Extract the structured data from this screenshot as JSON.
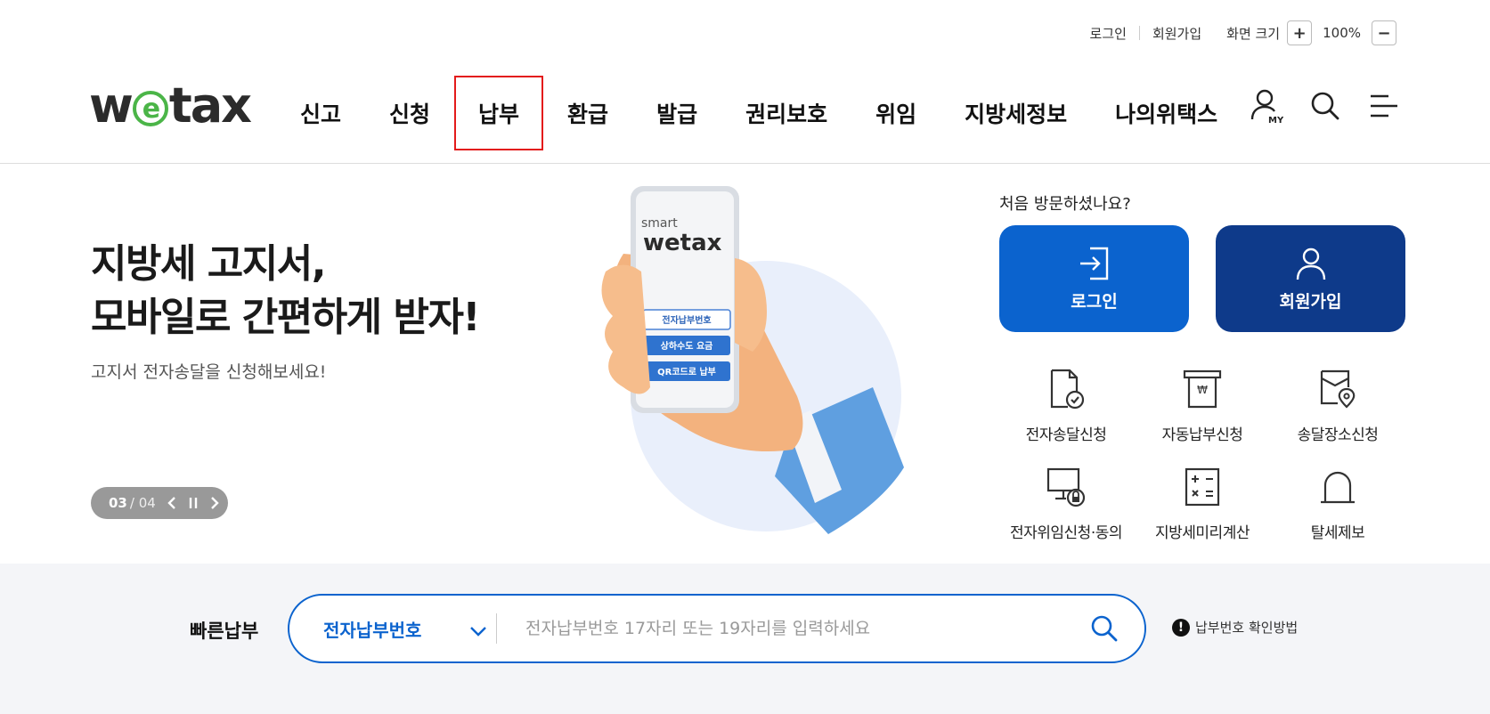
{
  "utility": {
    "login": "로그인",
    "join": "회원가입",
    "zoom_label": "화면 크기",
    "zoom_in": "+",
    "zoom_value": "100%",
    "zoom_out": "−"
  },
  "logo": {
    "before": "w",
    "circle": "e",
    "after": "tax"
  },
  "menu": [
    {
      "label": "신고"
    },
    {
      "label": "신청"
    },
    {
      "label": "납부"
    },
    {
      "label": "환급"
    },
    {
      "label": "발급"
    },
    {
      "label": "권리보호"
    },
    {
      "label": "위임"
    },
    {
      "label": "지방세정보"
    },
    {
      "label": "나의위택스"
    }
  ],
  "header_icons": {
    "my_label": "MY"
  },
  "hero": {
    "title_line1": "지방세 고지서,",
    "title_line2": "모바일로 간편하게 받자!",
    "subtitle": "고지서 전자송달을 신청해보세요!",
    "slide_current": "03",
    "slide_total": "/ 04",
    "phone": {
      "brand_small": "smart",
      "brand_logo": "wetax",
      "btn1": "전자납부번호",
      "btn2": "상하수도 요금",
      "btn3": "QR코드로 납부"
    }
  },
  "visit": {
    "question": "처음 방문하셨나요?",
    "login": "로그인",
    "join": "회원가입"
  },
  "services": [
    {
      "label": "전자송달신청"
    },
    {
      "label": "자동납부신청"
    },
    {
      "label": "송달장소신청"
    },
    {
      "label": "전자위임신청·동의"
    },
    {
      "label": "지방세미리계산"
    },
    {
      "label": "탈세제보"
    }
  ],
  "quick_pay": {
    "label": "빠른납부",
    "select_value": "전자납부번호",
    "placeholder": "전자납부번호 17자리 또는 19자리를 입력하세요",
    "help": "납부번호 확인방법"
  },
  "colors": {
    "primary": "#0b63ce",
    "navy": "#0e3a8a",
    "logo_green": "#4bb548",
    "active_outline": "#e31b1b"
  }
}
